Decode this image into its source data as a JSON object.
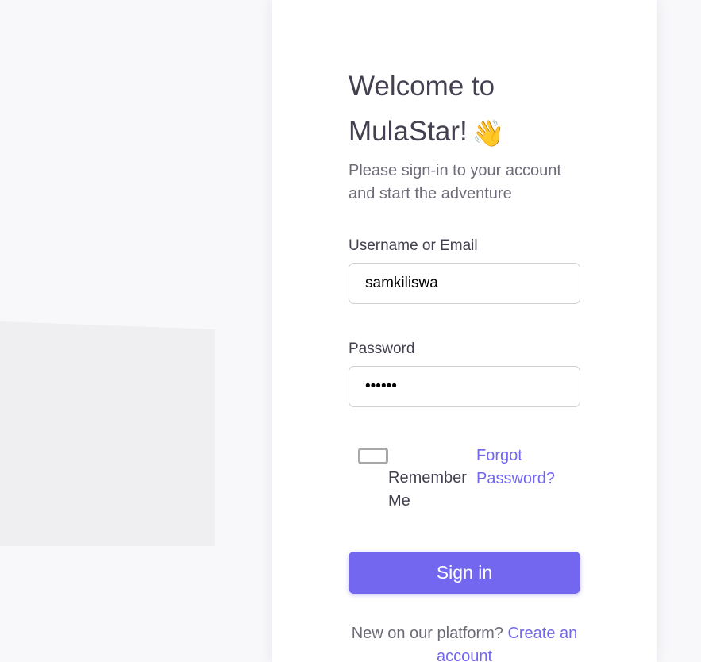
{
  "welcome": {
    "title_line1": "Welcome to",
    "title_line2": "MulaStar!",
    "wave_emoji": "👋",
    "subtitle": "Please sign-in to your account and start the adventure"
  },
  "form": {
    "username_label": "Username or Email",
    "username_value": "samkiliswa",
    "password_label": "Password",
    "password_value": "secret",
    "remember_label": "Remember Me",
    "remember_checked": false,
    "forgot_link": "Forgot Password?",
    "submit_label": "Sign in"
  },
  "signup": {
    "prompt": "New on our platform?",
    "link": "Create an account"
  },
  "colors": {
    "primary": "#7367f0",
    "heading": "#444050",
    "body_text": "#6d6b77",
    "page_background": "#f8f7fa"
  }
}
